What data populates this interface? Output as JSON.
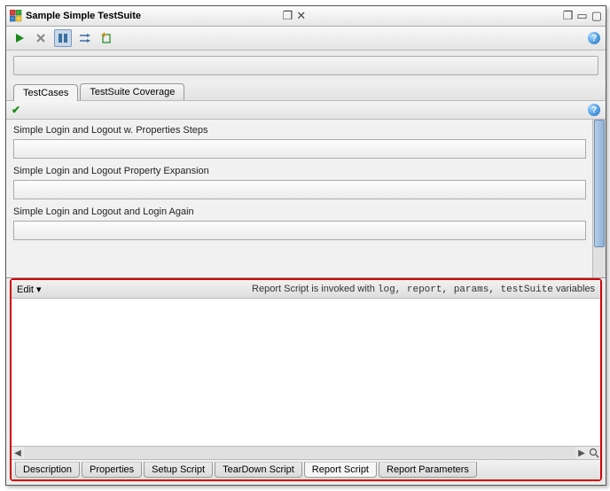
{
  "titlebar": {
    "title": "Sample Simple TestSuite"
  },
  "tabs": {
    "testcases": "TestCases",
    "coverage": "TestSuite Coverage"
  },
  "testcases": {
    "items": [
      {
        "label": "Simple Login and Logout w. Properties Steps"
      },
      {
        "label": "Simple Login and Logout Property Expansion"
      },
      {
        "label": "Simple Login and Logout and Login Again"
      }
    ]
  },
  "editZone": {
    "editLabel": "Edit ▾",
    "hintPrefix": "Report Script is invoked with ",
    "hintVars": "log, report, params, testSuite",
    "hintSuffix": " variables"
  },
  "bottomTabs": {
    "description": "Description",
    "properties": "Properties",
    "setupScript": "Setup Script",
    "teardownScript": "TearDown Script",
    "reportScript": "Report Script",
    "reportParameters": "Report Parameters"
  }
}
